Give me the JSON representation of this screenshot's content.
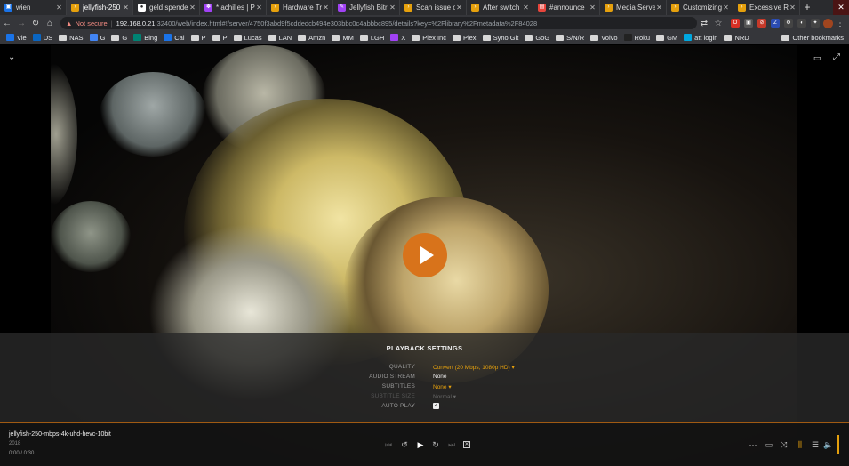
{
  "browser": {
    "tabs": [
      {
        "title": "wien",
        "color": "#1a73e8",
        "glyph": "▣",
        "active": false
      },
      {
        "title": "jellyfish-250",
        "color": "#e5a00d",
        "glyph": "›",
        "active": true
      },
      {
        "title": "geld spender",
        "color": "#ffffff",
        "glyph": "●",
        "active": false
      },
      {
        "title": "* achilles | P",
        "color": "#a142f4",
        "glyph": "✽",
        "active": false
      },
      {
        "title": "Hardware Tra",
        "color": "#e5a00d",
        "glyph": "›",
        "active": false
      },
      {
        "title": "Jellyfish Bitr",
        "color": "#a142f4",
        "glyph": "✎",
        "active": false
      },
      {
        "title": "Scan issue o",
        "color": "#e5a00d",
        "glyph": "›",
        "active": false
      },
      {
        "title": "After switch",
        "color": "#e5a00d",
        "glyph": "›",
        "active": false
      },
      {
        "title": "#announce",
        "color": "#e8453c",
        "glyph": "▤",
        "active": false
      },
      {
        "title": "Media Serve",
        "color": "#e5a00d",
        "glyph": "›",
        "active": false
      },
      {
        "title": "Customizing",
        "color": "#e5a00d",
        "glyph": "›",
        "active": false
      },
      {
        "title": "Excessive RA",
        "color": "#e5a00d",
        "glyph": "›",
        "active": false
      }
    ],
    "url": {
      "warning": "Not secure",
      "host": "192.168.0.21",
      "path": ":32400/web/index.html#!/server/4750f3abd9f5cddedcb494e303bbc0c4abbbc895/details?key=%2Flibrary%2Fmetadata%2F84028"
    },
    "bookmarks": [
      {
        "label": "Vie",
        "type": "icon",
        "color": "#1a73e8"
      },
      {
        "label": "DS",
        "type": "icon",
        "color": "#0a66c2"
      },
      {
        "label": "NAS",
        "type": "folder"
      },
      {
        "label": "G",
        "type": "icon",
        "color": "#4285f4"
      },
      {
        "label": "G",
        "type": "folder"
      },
      {
        "label": "Bing",
        "type": "icon",
        "color": "#008373"
      },
      {
        "label": "Cal",
        "type": "icon",
        "color": "#1a73e8"
      },
      {
        "label": "P",
        "type": "folder"
      },
      {
        "label": "P",
        "type": "folder"
      },
      {
        "label": "Lucas",
        "type": "folder"
      },
      {
        "label": "LAN",
        "type": "folder"
      },
      {
        "label": "Amzn",
        "type": "folder"
      },
      {
        "label": "MM",
        "type": "folder"
      },
      {
        "label": "LGH",
        "type": "folder"
      },
      {
        "label": "X",
        "type": "icon",
        "color": "#a142f4"
      },
      {
        "label": "Plex Inc",
        "type": "folder"
      },
      {
        "label": "Plex",
        "type": "folder"
      },
      {
        "label": "Syno Git",
        "type": "folder"
      },
      {
        "label": "GoG",
        "type": "folder"
      },
      {
        "label": "S/N/R",
        "type": "folder"
      },
      {
        "label": "Volvo",
        "type": "folder"
      },
      {
        "label": "Roku",
        "type": "icon",
        "color": "#222222"
      },
      {
        "label": "GM",
        "type": "folder"
      },
      {
        "label": "att login",
        "type": "icon",
        "color": "#00a8e0"
      },
      {
        "label": "NRD",
        "type": "folder"
      }
    ],
    "other_bookmarks": "Other bookmarks"
  },
  "settings": {
    "title": "PLAYBACK SETTINGS",
    "quality_label": "QUALITY",
    "quality_value": "Convert (20 Mbps, 1080p HD)",
    "audio_label": "AUDIO STREAM",
    "audio_value": "None",
    "subtitles_label": "SUBTITLES",
    "subtitles_value": "None",
    "subsize_label": "SUBTITLE SIZE",
    "subsize_value": "Normal",
    "autoplay_label": "AUTO PLAY",
    "autoplay_checked": true
  },
  "media": {
    "title": "jellyfish-250-mbps-4k-uhd-hevc-10bit",
    "year": "2018",
    "time": "0:00 / 0:30"
  },
  "colors": {
    "accent": "#e5a00d",
    "play_button": "#d8731b"
  }
}
